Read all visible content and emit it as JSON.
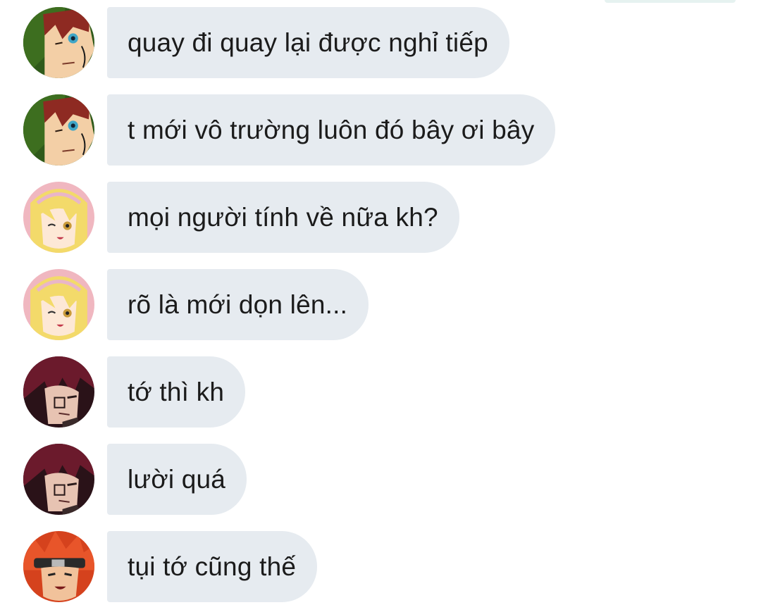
{
  "messages": [
    {
      "text": "quay đi quay lại được nghỉ tiếp",
      "avatar": "green-hood-redhair-avatar"
    },
    {
      "text": "t mới vô trường luôn đó bây ơi bây",
      "avatar": "green-hood-redhair-avatar"
    },
    {
      "text": "mọi người tính về nữa kh?",
      "avatar": "blonde-girl-avatar"
    },
    {
      "text": "rõ là mới dọn lên...",
      "avatar": "blonde-girl-avatar"
    },
    {
      "text": "tớ thì kh",
      "avatar": "dark-red-hair-avatar"
    },
    {
      "text": "lười quá",
      "avatar": "dark-red-hair-avatar"
    },
    {
      "text": "tụi tớ cũng thế",
      "avatar": "red-hair-headband-avatar"
    }
  ],
  "colors": {
    "bubble": "#e6ebf0",
    "text": "#1b1b1b",
    "background": "#ffffff"
  }
}
